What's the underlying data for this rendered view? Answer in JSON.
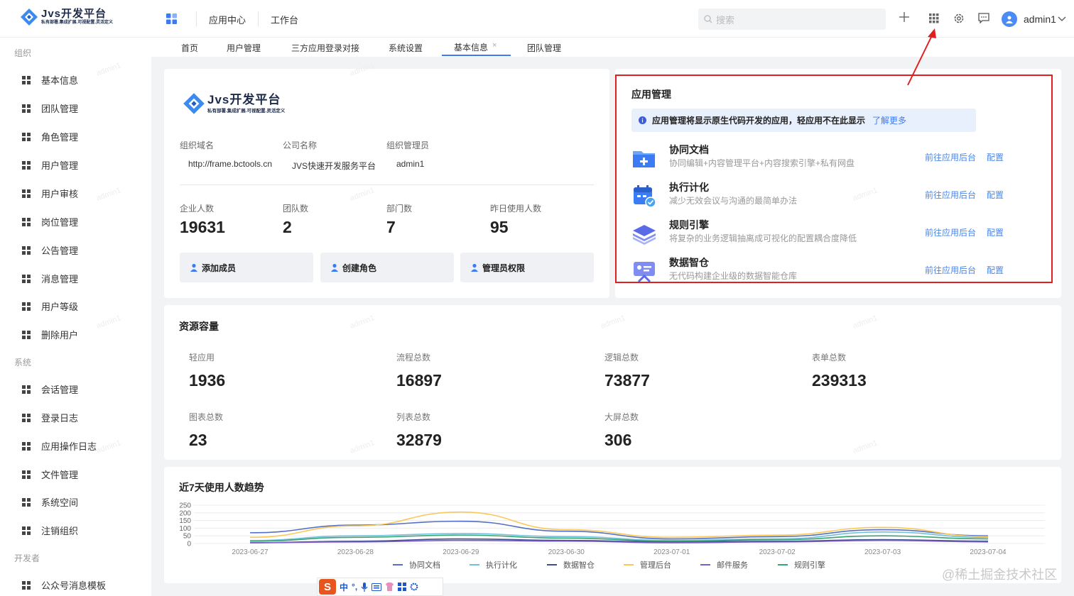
{
  "brand": {
    "name": "Jvs开发平台",
    "slogan": "私有部署.集成扩展.可视配置.灵活定义"
  },
  "topnav": {
    "items": [
      "应用中心",
      "工作台"
    ]
  },
  "search": {
    "placeholder": "搜索"
  },
  "user": {
    "name": "admin1"
  },
  "sidebar": {
    "groups": [
      {
        "label": "组织",
        "items": [
          "基本信息",
          "团队管理",
          "角色管理",
          "用户管理",
          "用户审核",
          "岗位管理",
          "公告管理",
          "消息管理",
          "用户等级",
          "删除用户"
        ]
      },
      {
        "label": "系统",
        "items": [
          "会话管理",
          "登录日志",
          "应用操作日志",
          "文件管理",
          "系统空间",
          "注销组织"
        ]
      },
      {
        "label": "开发者",
        "items": [
          "公众号消息模板"
        ]
      }
    ]
  },
  "tabs": [
    "首页",
    "用户管理",
    "三方应用登录对接",
    "系统设置",
    "基本信息",
    "团队管理"
  ],
  "org": {
    "domain_label": "组织域名",
    "domain": "http://frame.bctools.cn",
    "company_label": "公司名称",
    "company": "JVS快速开发服务平台",
    "admin_label": "组织管理员",
    "admin": "admin1",
    "stats": [
      {
        "label": "企业人数",
        "value": "19631"
      },
      {
        "label": "团队数",
        "value": "2"
      },
      {
        "label": "部门数",
        "value": "7"
      },
      {
        "label": "昨日使用人数",
        "value": "95"
      }
    ],
    "buttons": [
      "添加成员",
      "创建角色",
      "管理员权限"
    ]
  },
  "apps": {
    "title": "应用管理",
    "notice": "应用管理将显示原生代码开发的应用，轻应用不在此显示",
    "notice_link": "了解更多",
    "go_label": "前往应用后台",
    "config_label": "配置",
    "items": [
      {
        "name": "协同文档",
        "desc": "协同编辑+内容管理平台+内容搜索引擎+私有网盘",
        "icon": "folder-plus-icon"
      },
      {
        "name": "执行计化",
        "desc": "减少无效会议与沟通的最简单办法",
        "icon": "calendar-check-icon"
      },
      {
        "name": "规则引擎",
        "desc": "将复杂的业务逻辑抽离成可视化的配置耦合度降低",
        "icon": "layers-icon"
      },
      {
        "name": "数据智仓",
        "desc": "无代码构建企业级的数据智能仓库",
        "icon": "data-screen-icon"
      }
    ]
  },
  "resources": {
    "title": "资源容量",
    "items": [
      {
        "label": "轻应用",
        "value": "1936"
      },
      {
        "label": "流程总数",
        "value": "16897"
      },
      {
        "label": "逻辑总数",
        "value": "73877"
      },
      {
        "label": "表单总数",
        "value": "239313"
      },
      {
        "label": "图表总数",
        "value": "23"
      },
      {
        "label": "列表总数",
        "value": "32879"
      },
      {
        "label": "大屏总数",
        "value": "306"
      }
    ]
  },
  "trend": {
    "title": "近7天使用人数趋势"
  },
  "watermark": "admin1",
  "footnote": "@稀土掘金技术社区",
  "ime": {
    "zh": "中"
  },
  "chart_data": {
    "type": "line",
    "x": [
      "2023-06-27",
      "2023-06-28",
      "2023-06-29",
      "2023-06-30",
      "2023-07-01",
      "2023-07-02",
      "2023-07-03",
      "2023-07-04"
    ],
    "yticks": [
      0,
      50,
      100,
      150,
      200,
      250
    ],
    "ylim": [
      0,
      250
    ],
    "legend_position": "bottom",
    "grid": true,
    "series": [
      {
        "name": "协同文档",
        "color": "#5470c6",
        "values": [
          70,
          120,
          145,
          80,
          30,
          45,
          90,
          50
        ]
      },
      {
        "name": "执行计化",
        "color": "#73c0de",
        "values": [
          20,
          50,
          65,
          45,
          20,
          30,
          75,
          40
        ]
      },
      {
        "name": "数据智仓",
        "color": "#3f4f8a",
        "values": [
          5,
          15,
          30,
          20,
          10,
          15,
          25,
          15
        ]
      },
      {
        "name": "管理后台",
        "color": "#fac858",
        "values": [
          40,
          115,
          205,
          90,
          40,
          55,
          105,
          45
        ]
      },
      {
        "name": "邮件服务",
        "color": "#7b5fc5",
        "values": [
          5,
          10,
          20,
          15,
          5,
          10,
          20,
          10
        ]
      },
      {
        "name": "规则引擎",
        "color": "#3ba272",
        "values": [
          15,
          40,
          55,
          35,
          15,
          25,
          50,
          30
        ]
      }
    ]
  }
}
